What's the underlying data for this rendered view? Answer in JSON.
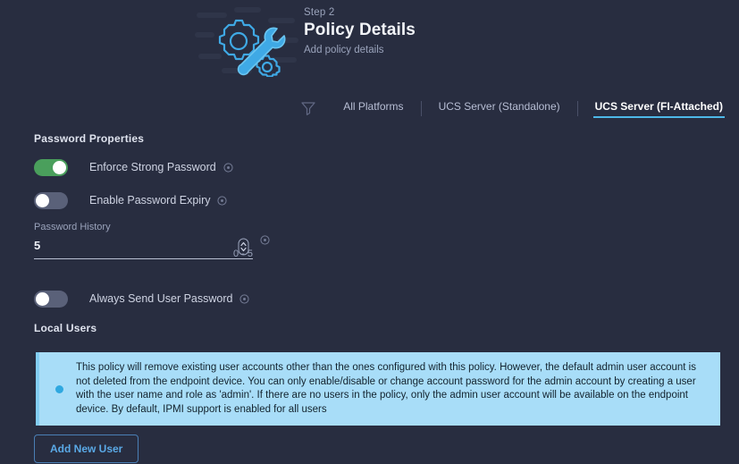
{
  "header": {
    "step_label": "Step 2",
    "title": "Policy Details",
    "subtitle": "Add policy details",
    "illustration_icon": "gear-wrench-illustration"
  },
  "tabbar": {
    "filter_icon": "filter-funnel-icon",
    "tabs": [
      {
        "label": "All Platforms",
        "active": false
      },
      {
        "label": "UCS Server (Standalone)",
        "active": false
      },
      {
        "label": "UCS Server (FI-Attached)",
        "active": true
      }
    ],
    "active_underline_color": "#4db8e8"
  },
  "sections": {
    "password_properties_title": "Password Properties",
    "local_users_title": "Local Users"
  },
  "toggles": [
    {
      "label": "Enforce Strong Password",
      "state": "on",
      "on_color": "#4a9f5c",
      "info_icon": "info-circle-icon"
    },
    {
      "label": "Enable Password Expiry",
      "state": "off",
      "off_color": "#5a6179",
      "info_icon": "info-circle-icon"
    },
    {
      "label": "Always Send User Password",
      "state": "off",
      "off_color": "#5a6179",
      "info_icon": "info-circle-icon"
    }
  ],
  "password_history": {
    "label": "Password History",
    "value": "5",
    "placeholder": "0",
    "hint": "0 - 5",
    "stepper_icon": "number-stepper-icon",
    "info_icon": "info-circle-icon"
  },
  "banner": {
    "dot_icon": "info-dot-icon",
    "background": "#a8ddf8",
    "text": "This policy will remove existing user accounts other than the ones configured with this policy. However, the default admin user account is not deleted from the endpoint device. You can only enable/disable or change account password for the admin account by creating a user with the user name and role as 'admin'. If there are no users in the policy, only the admin user account will be available on the endpoint device. By default, IPMI support is enabled for all users"
  },
  "buttons": {
    "add_new_user": "Add New User"
  },
  "theme": {
    "background": "#282d40",
    "accent": "#4db8e8"
  }
}
